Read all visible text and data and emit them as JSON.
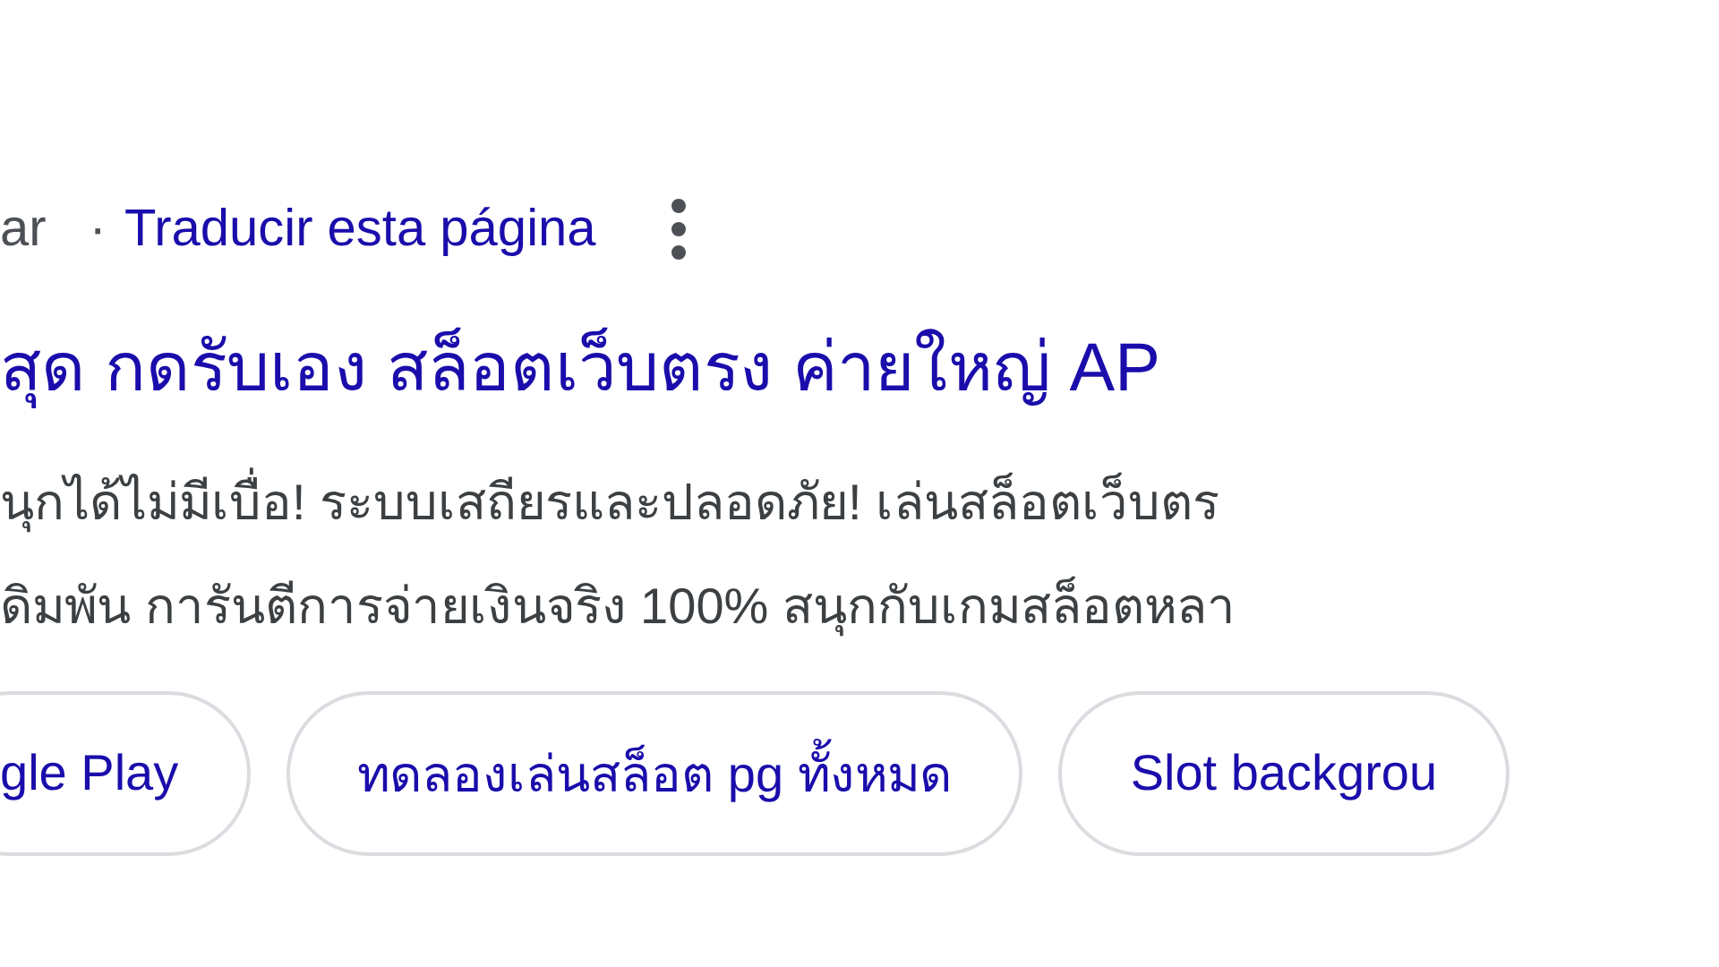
{
  "breadcrumb": {
    "site": "ar",
    "separator": "·",
    "translate_link": "Traducir esta página"
  },
  "result_title": "สุด กดรับเอง สล็อตเว็บตรง ค่ายใหญ่ AP",
  "snippet_lines": [
    "นุกได้ไม่มีเบื่อ! ระบบเสถียรและปลอดภัย! เล่นสล็อตเว็บตร",
    "ดิมพัน การันตีการจ่ายเงินจริง 100% สนุกกับเกมสล็อตหลา"
  ],
  "related_chips": [
    "gle Play",
    "ทดลองเล่นสล็อต pg ทั้งหมด",
    "Slot backgrou"
  ]
}
